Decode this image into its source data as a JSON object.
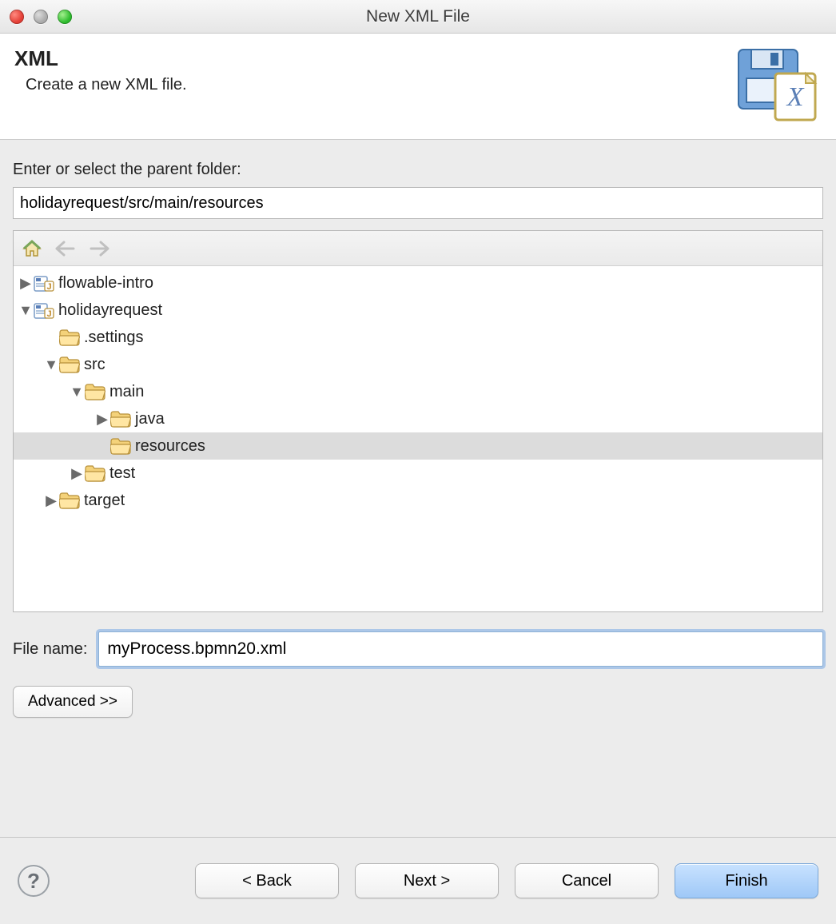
{
  "window": {
    "title": "New XML File"
  },
  "banner": {
    "heading": "XML",
    "subheading": "Create a new XML file."
  },
  "parent": {
    "label": "Enter or select the parent folder:",
    "value": "holidayrequest/src/main/resources"
  },
  "tree": {
    "nodes": [
      {
        "label": "flowable-intro",
        "level": 0,
        "expanded": false,
        "hasArrow": true,
        "icon": "project",
        "selected": false
      },
      {
        "label": "holidayrequest",
        "level": 0,
        "expanded": true,
        "hasArrow": true,
        "icon": "project",
        "selected": false
      },
      {
        "label": ".settings",
        "level": 1,
        "expanded": false,
        "hasArrow": false,
        "icon": "folder",
        "selected": false
      },
      {
        "label": "src",
        "level": 1,
        "expanded": true,
        "hasArrow": true,
        "icon": "folder",
        "selected": false
      },
      {
        "label": "main",
        "level": 2,
        "expanded": true,
        "hasArrow": true,
        "icon": "folder",
        "selected": false
      },
      {
        "label": "java",
        "level": 3,
        "expanded": false,
        "hasArrow": true,
        "icon": "folder",
        "selected": false
      },
      {
        "label": "resources",
        "level": 3,
        "expanded": false,
        "hasArrow": false,
        "icon": "folder",
        "selected": true
      },
      {
        "label": "test",
        "level": 2,
        "expanded": false,
        "hasArrow": true,
        "icon": "folder",
        "selected": false
      },
      {
        "label": "target",
        "level": 1,
        "expanded": false,
        "hasArrow": true,
        "icon": "folder",
        "selected": false
      }
    ]
  },
  "filename": {
    "label": "File name:",
    "value": "myProcess.bpmn20.xml"
  },
  "buttons": {
    "advanced": "Advanced >>",
    "back": "< Back",
    "next": "Next >",
    "cancel": "Cancel",
    "finish": "Finish"
  }
}
